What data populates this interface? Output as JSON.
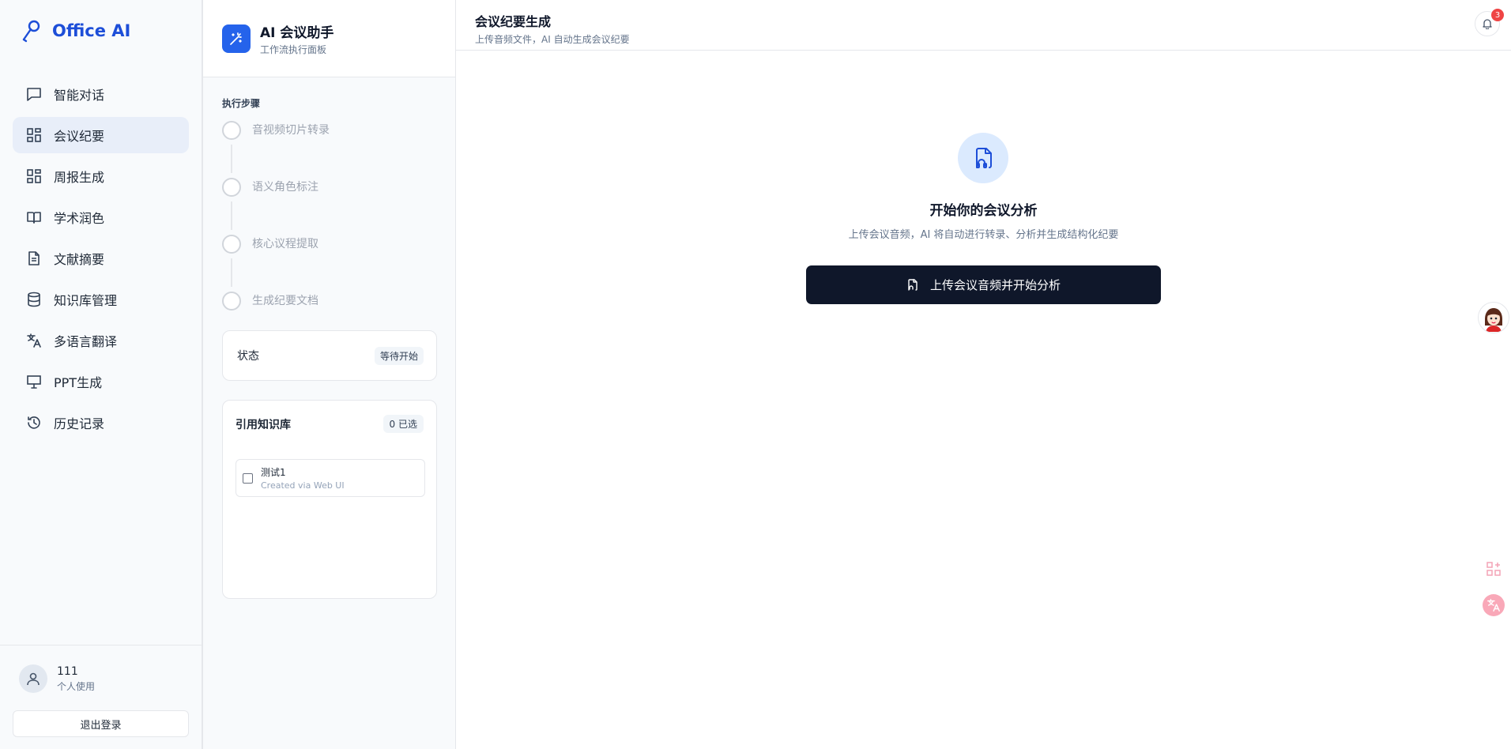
{
  "brand": {
    "name": "Office AI"
  },
  "sidebar": {
    "items": [
      {
        "label": "智能对话",
        "icon": "chat-icon",
        "active": false
      },
      {
        "label": "会议纪要",
        "icon": "grid-icon",
        "active": true
      },
      {
        "label": "周报生成",
        "icon": "grid-icon",
        "active": false
      },
      {
        "label": "学术润色",
        "icon": "book-icon",
        "active": false
      },
      {
        "label": "文献摘要",
        "icon": "document-icon",
        "active": false
      },
      {
        "label": "知识库管理",
        "icon": "database-icon",
        "active": false
      },
      {
        "label": "多语言翻译",
        "icon": "translate-icon",
        "active": false
      },
      {
        "label": "PPT生成",
        "icon": "presentation-icon",
        "active": false
      },
      {
        "label": "历史记录",
        "icon": "history-icon",
        "active": false
      }
    ]
  },
  "user": {
    "name": "111",
    "plan": "个人使用",
    "logout_label": "退出登录"
  },
  "panel": {
    "title": "AI 会议助手",
    "subtitle": "工作流执行面板",
    "steps_label": "执行步骤",
    "steps": [
      "音视频切片转录",
      "语义角色标注",
      "核心议程提取",
      "生成纪要文档"
    ],
    "status_label": "状态",
    "status_value": "等待开始",
    "kb": {
      "title": "引用知识库",
      "count_label": "0 已选",
      "items": [
        {
          "name": "测试1",
          "desc": "Created via Web UI",
          "checked": false
        }
      ]
    }
  },
  "main": {
    "title": "会议纪要生成",
    "subtitle": "上传音频文件，AI 自动生成会议纪要",
    "notification_count": "3",
    "empty_title": "开始你的会议分析",
    "empty_desc": "上传会议音频，AI 将自动进行转录、分析并生成结构化纪要",
    "upload_label": "上传会议音频并开始分析"
  },
  "colors": {
    "brand": "#1d4ed8",
    "accent": "#2563eb",
    "primary_button": "#0f172a",
    "badge_red": "#ef4444",
    "active_nav": "#e8eef9"
  }
}
